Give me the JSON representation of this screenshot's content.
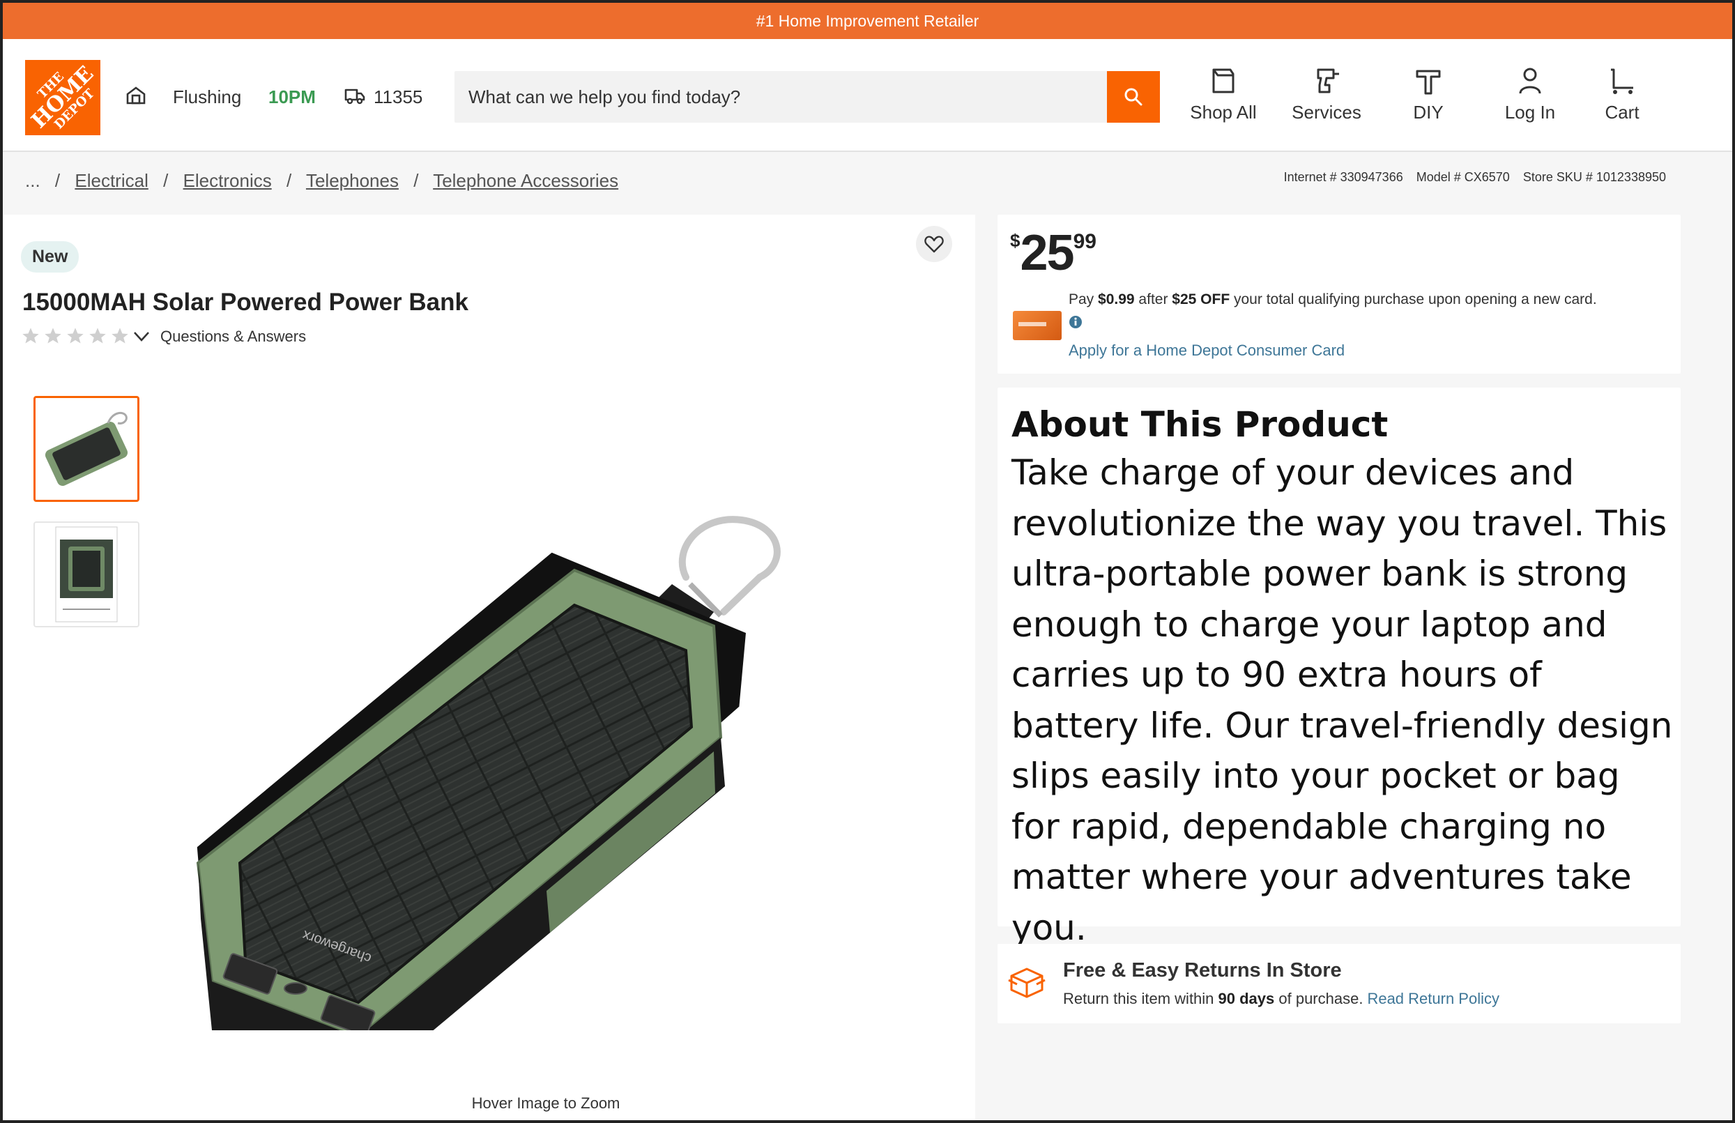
{
  "promo": {
    "text": "#1 Home Improvement Retailer"
  },
  "logo": {
    "line1": "THE",
    "line2": "HOME",
    "line3": "DEPOT"
  },
  "header": {
    "store_name": "Flushing",
    "store_hours": "10PM",
    "zip": "11355",
    "search_placeholder": "What can we help you find today?",
    "nav": [
      {
        "label": "Shop All",
        "icon": "shop-all-icon"
      },
      {
        "label": "Services",
        "icon": "drill-icon"
      },
      {
        "label": "DIY",
        "icon": "hammer-icon"
      },
      {
        "label": "Log In",
        "icon": "user-icon"
      },
      {
        "label": "Cart",
        "icon": "cart-icon"
      }
    ]
  },
  "breadcrumb": {
    "ellipsis": "...",
    "items": [
      "Electrical",
      "Electronics",
      "Telephones",
      "Telephone Accessories"
    ]
  },
  "identifiers": {
    "internet": "Internet # 330947366",
    "model": "Model # CX6570",
    "store_sku": "Store SKU # 1012338950"
  },
  "product": {
    "badge": "New",
    "title": "15000MAH Solar Powered Power Bank",
    "rating": 0,
    "qa_label": "Questions & Answers",
    "zoom_hint": "Hover Image to Zoom",
    "brand_print": "chargeworx",
    "package_label": "Power Bank"
  },
  "pricing": {
    "currency": "$",
    "dollars": "25",
    "cents": "99",
    "card_offer": {
      "prefix": "Pay ",
      "pay_amount": "$0.99",
      "middle": " after ",
      "discount": "$25 OFF",
      "suffix": " your total qualifying purchase upon opening a new card."
    },
    "apply_link": "Apply for a Home Depot Consumer Card"
  },
  "about": {
    "title": "About This Product",
    "body": "Take charge of your devices and revolutionize the way you travel. This ultra-portable power bank is strong enough to charge your laptop and carries up to 90 extra hours of battery life. Our travel-friendly design slips easily into your pocket or bag for rapid, dependable charging no matter where your adventures take you."
  },
  "returns": {
    "title": "Free & Easy Returns In Store",
    "text_prefix": "Return this item within ",
    "days": "90 days",
    "text_suffix": " of purchase.",
    "link": "Read Return Policy"
  },
  "colors": {
    "brand_orange": "#f96302",
    "promo_orange": "#ed6d2d",
    "hours_green": "#3b9a52",
    "link_blue": "#3e7697",
    "product_green": "#7e9a72"
  }
}
